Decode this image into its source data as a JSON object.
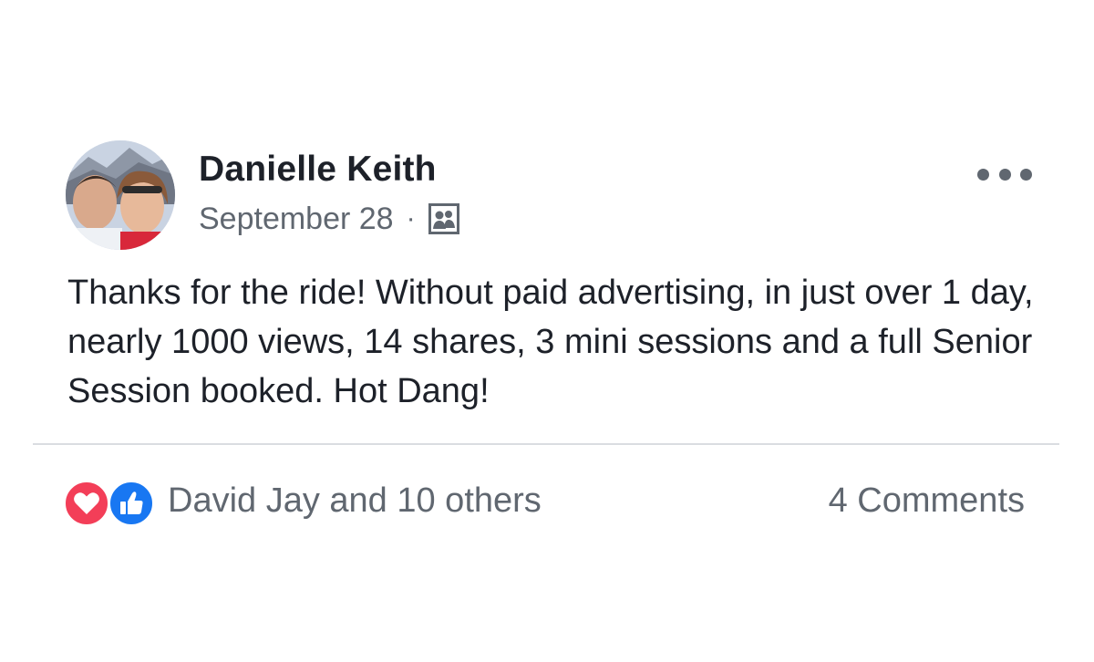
{
  "post": {
    "author_name": "Danielle Keith",
    "date": "September 28",
    "separator": "·",
    "audience_icon": "friends-group-icon",
    "more_icon": "more-options-icon",
    "text": "Thanks for the ride!  Without paid advertising, in just over 1 day, nearly 1000 views, 14 shares, 3 mini sessions and a full Senior Session booked. Hot Dang!"
  },
  "footer": {
    "reactions": [
      "love-reaction-icon",
      "like-reaction-icon"
    ],
    "reaction_summary": "David Jay and 10 others",
    "comments_count": "4 Comments"
  },
  "colors": {
    "text_primary": "#1d2129",
    "text_secondary": "#606770",
    "love": "#f33e58",
    "like": "#1877f2",
    "divider": "#dadde1"
  }
}
